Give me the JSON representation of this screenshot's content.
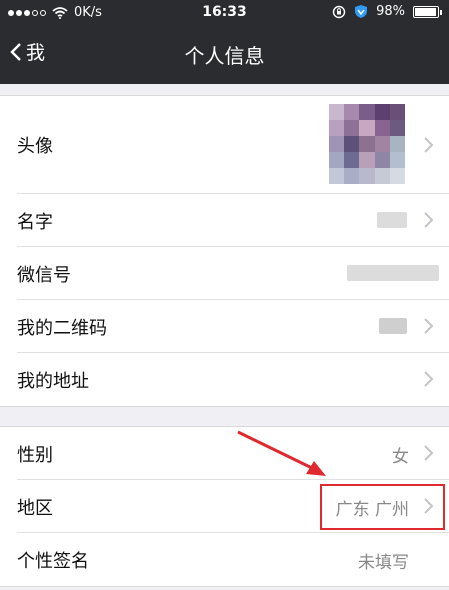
{
  "status": {
    "carrier_speed": "0K/s",
    "time": "16:33",
    "battery": "98%"
  },
  "nav": {
    "back_label": "我",
    "title": "个人信息"
  },
  "group1": {
    "avatar_label": "头像",
    "name_label": "名字",
    "wechat_id_label": "微信号",
    "qrcode_label": "我的二维码",
    "address_label": "我的地址"
  },
  "group2": {
    "gender_label": "性别",
    "gender_value": "女",
    "region_label": "地区",
    "region_value": "广东 广州",
    "signature_label": "个性签名",
    "signature_value": "未填写"
  },
  "colors": {
    "nav_bg": "#2b2c30",
    "accent_red": "#e0282f"
  },
  "icons": [
    "wifi-icon",
    "rotation-lock-icon",
    "shield-icon",
    "battery-icon",
    "chevron-left-icon",
    "chevron-right-icon",
    "arrow-icon"
  ]
}
